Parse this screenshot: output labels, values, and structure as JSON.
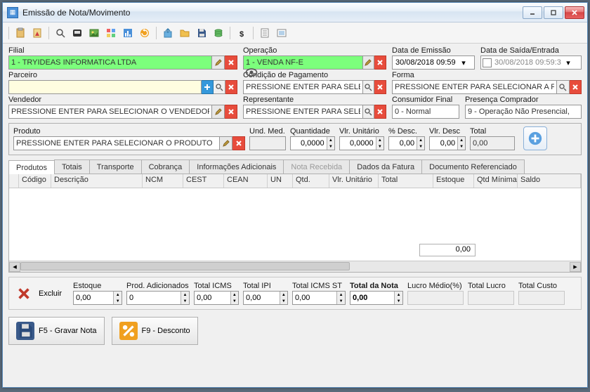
{
  "window": {
    "title": "Emissão de Nota/Movimento"
  },
  "labels": {
    "filial": "Filial",
    "operacao": "Operação",
    "dataEmissao": "Data de Emissão",
    "dataSaida": "Data de Saída/Entrada",
    "parceiro": "Parceiro",
    "condPag": "Condição de Pagamento",
    "forma": "Forma",
    "vendedor": "Vendedor",
    "representante": "Representante",
    "consumidorFinal": "Consumidor Final",
    "presencaComprador": "Presença Comprador",
    "produto": "Produto",
    "undMed": "Und. Med.",
    "quantidade": "Quantidade",
    "vlrUnitario": "Vlr. Unitário",
    "pctDesc": "% Desc.",
    "vlrDesc": "Vlr. Desc",
    "total": "Total",
    "excluir": "Excluir",
    "estoque": "Estoque",
    "prodAdicionados": "Prod. Adicionados",
    "totalICMS": "Total ICMS",
    "totalIPI": "Total IPI",
    "totalICMSST": "Total ICMS ST",
    "totalDaNota": "Total da Nota",
    "lucroMedioPct": "Lucro Médio(%)",
    "totalLucro": "Total Lucro",
    "totalCusto": "Total Custo"
  },
  "values": {
    "filial": "1 - TRYIDEAS INFORMATICA LTDA",
    "operacao": "1 - VENDA NF-E",
    "dataEmissao": "30/08/2018 09:59",
    "dataSaida": "30/08/2018 09:59:3",
    "parceiro": "",
    "condPagPlaceholder": "PRESSIONE ENTER PARA SELECIONAR A C",
    "formaPlaceholder": "PRESSIONE ENTER PARA SELECIONAR A FORMA",
    "vendedorPlaceholder": "PRESSIONE ENTER PARA SELECIONAR O VENDEDOR",
    "representantePlaceholder": "PRESSIONE ENTER PARA SELECIONAR O R",
    "consumidorFinal": "0 - Normal",
    "presencaComprador": "9 - Operação Não Presencial, ",
    "produtoPlaceholder": "PRESSIONE ENTER PARA SELECIONAR O PRODUTO",
    "undMed": "",
    "quantidade": "0,0000",
    "vlrUnitario": "0,0000",
    "pctDesc": "0,00",
    "vlrDesc": "0,00",
    "total": "0,00",
    "gridFooter": "0,00",
    "estoque": "0,00",
    "prodAdicionados": "0",
    "totalICMS": "0,00",
    "totalIPI": "0,00",
    "totalICMSST": "0,00",
    "totalDaNota": "0,00"
  },
  "tabs": {
    "produtos": "Produtos",
    "totais": "Totais",
    "transporte": "Transporte",
    "cobranca": "Cobrança",
    "informacoes": "Informações Adicionais",
    "notaRecebida": "Nota Recebida",
    "dadosFatura": "Dados da Fatura",
    "docRef": "Documento Referenciado"
  },
  "gridHeaders": {
    "codigo": "Código",
    "descricao": "Descrição",
    "ncm": "NCM",
    "cest": "CEST",
    "cean": "CEAN",
    "un": "UN",
    "qtd": "Qtd.",
    "vlrUnitario": "Vlr. Unitário",
    "total": "Total",
    "estoque": "Estoque",
    "qtdMinima": "Qtd Mínima",
    "saldo": "Saldo"
  },
  "buttons": {
    "gravar": "F5 - Gravar Nota",
    "desconto": "F9 - Desconto"
  }
}
